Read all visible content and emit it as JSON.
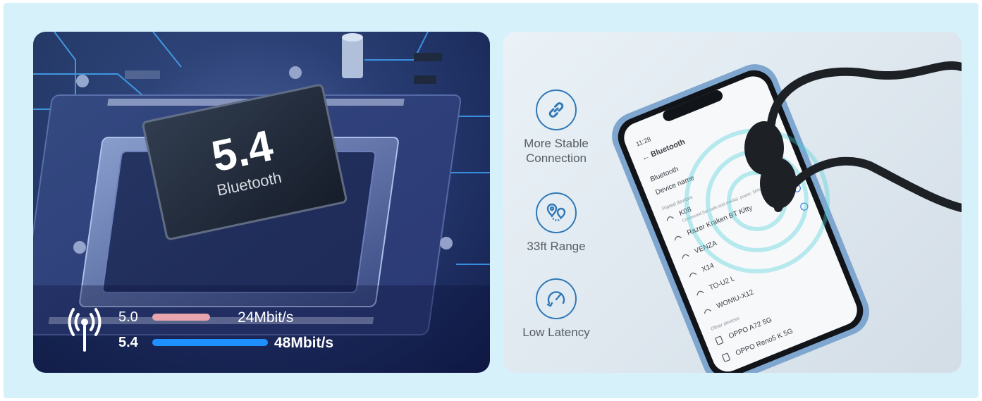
{
  "chip": {
    "version": "5.4",
    "name": "Bluetooth"
  },
  "speed_comparison": [
    {
      "version": "5.0",
      "speed": "24Mbit/s",
      "fraction": 0.5,
      "color": "#e8a5ad"
    },
    {
      "version": "5.4",
      "speed": "48Mbit/s",
      "fraction": 1.0,
      "color": "#1e90ff"
    }
  ],
  "features": [
    {
      "icon": "link-icon",
      "label": "More Stable Connection"
    },
    {
      "icon": "range-pin-icon",
      "label": "33ft Range"
    },
    {
      "icon": "speedometer-icon",
      "label": "Low Latency"
    }
  ],
  "phone": {
    "status_time": "11:28",
    "title": "Bluetooth",
    "rows": {
      "bluetooth": "Bluetooth",
      "device_name": "Device name",
      "paired_header": "Paired devices",
      "k08": "K08",
      "k08_sub": "Connected (for calls and media), power: 50%",
      "razer": "Razer Kraken BT Kitty",
      "venza": "VENZA",
      "x14": "X14",
      "tou2": "TO-U2 L",
      "woniu": "WONIU-X12",
      "other_header": "Other devices",
      "oppo_a72": "OPPO A72 5G",
      "oppo_reno": "OPPO Reno5 K 5G"
    }
  },
  "colors": {
    "frame_bg": "#d7f1fb",
    "accent_blue": "#2f78b7",
    "bar_5_0": "#e8a5ad",
    "bar_5_4": "#1e90ff"
  }
}
